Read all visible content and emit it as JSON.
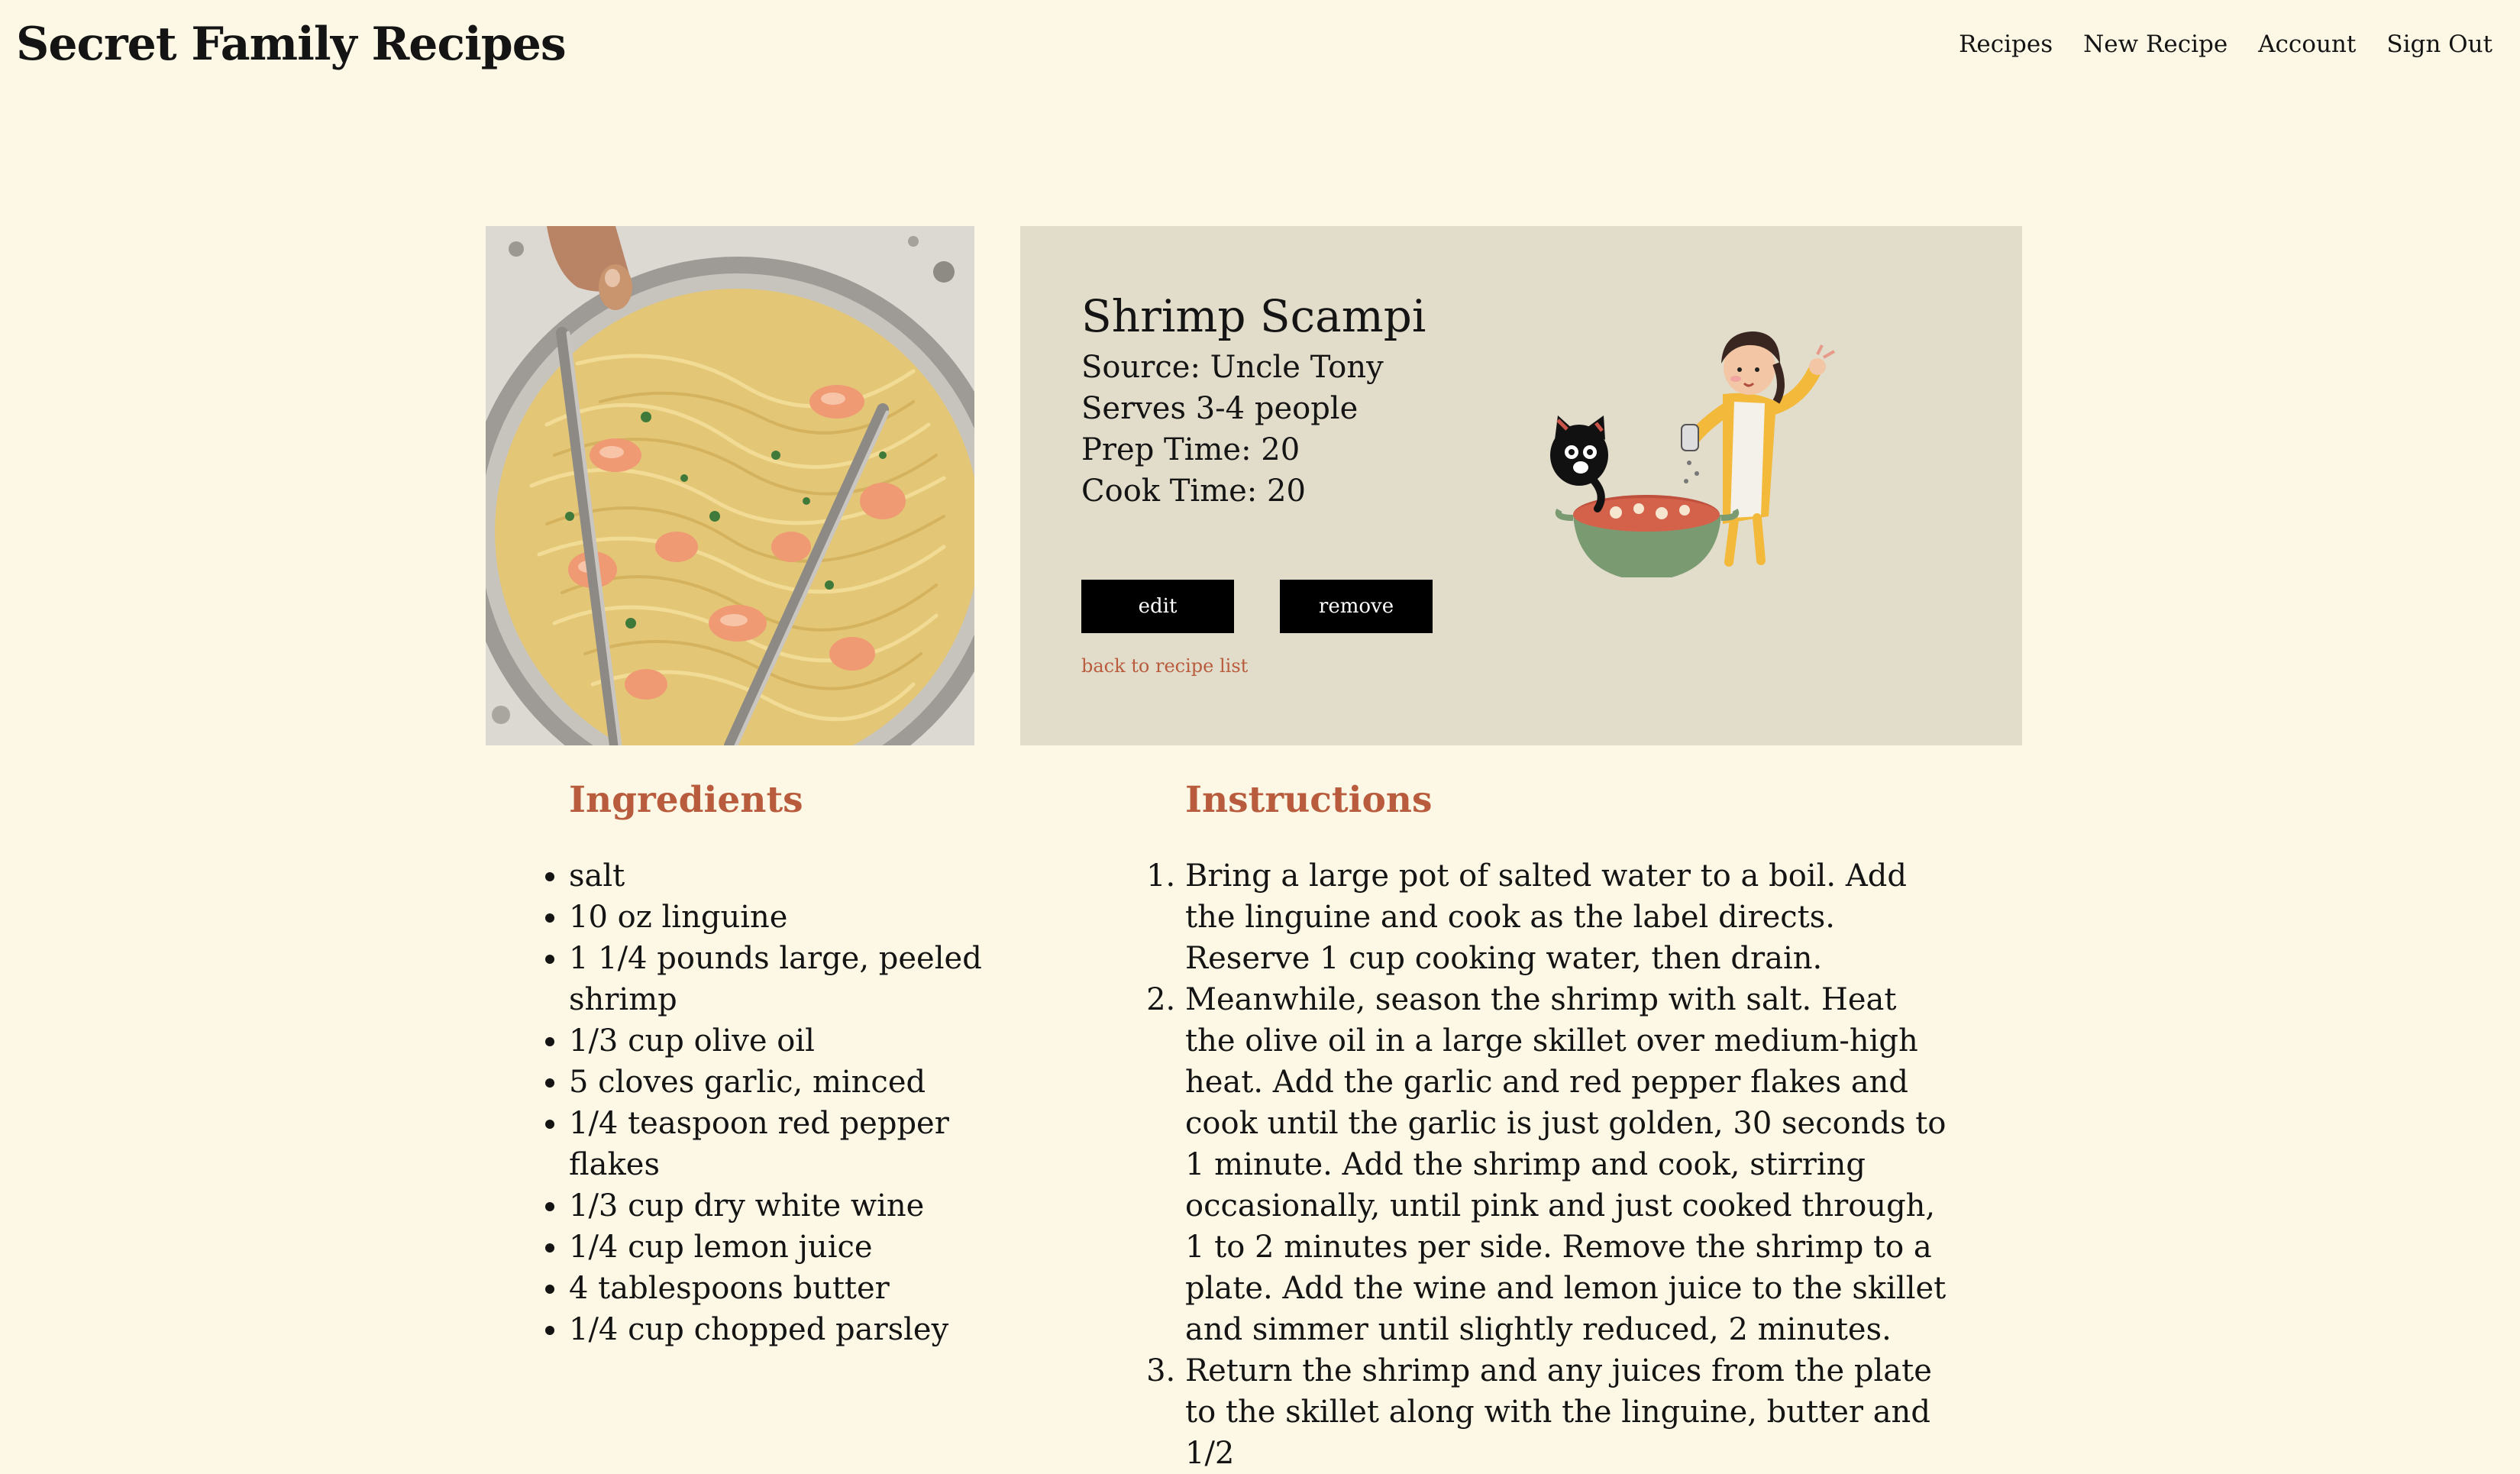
{
  "header": {
    "site_title": "Secret Family Recipes",
    "nav": [
      "Recipes",
      "New Recipe",
      "Account",
      "Sign Out"
    ]
  },
  "recipe": {
    "title": "Shrimp Scampi",
    "source": "Source: Uncle Tony",
    "serves": "Serves 3-4 people",
    "prep_time": "Prep Time: 20",
    "cook_time": "Cook Time: 20",
    "edit_label": "edit",
    "remove_label": "remove",
    "back_link": "back to recipe list"
  },
  "ingredients": {
    "heading": "Ingredients",
    "items": [
      "salt",
      "10 oz linguine",
      "1 1/4 pounds large, peeled shrimp",
      "1/3 cup olive oil",
      "5 cloves garlic, minced",
      "1/4 teaspoon red pepper flakes",
      "1/3 cup dry white wine",
      "1/4 cup lemon juice",
      "4 tablespoons butter",
      "1/4 cup chopped parsley"
    ]
  },
  "instructions": {
    "heading": "Instructions",
    "steps": [
      "Bring a large pot of salted water to a boil. Add the linguine and cook as the label directs. Reserve 1 cup cooking water, then drain.",
      "Meanwhile, season the shrimp with salt. Heat the olive oil in a large skillet over medium-high heat. Add the garlic and red pepper flakes and cook until the garlic is just golden, 30 seconds to 1 minute. Add the shrimp and cook, stirring occasionally, until pink and just cooked through, 1 to 2 minutes per side. Remove the shrimp to a plate. Add the wine and lemon juice to the skillet and simmer until slightly reduced, 2 minutes.",
      "Return the shrimp and any juices from the plate to the skillet along with the linguine, butter and 1/2"
    ]
  },
  "colors": {
    "page_background": "#fdf8e5",
    "card_background": "#e2dcca",
    "accent": "#b85c3d",
    "button": "#000000"
  }
}
